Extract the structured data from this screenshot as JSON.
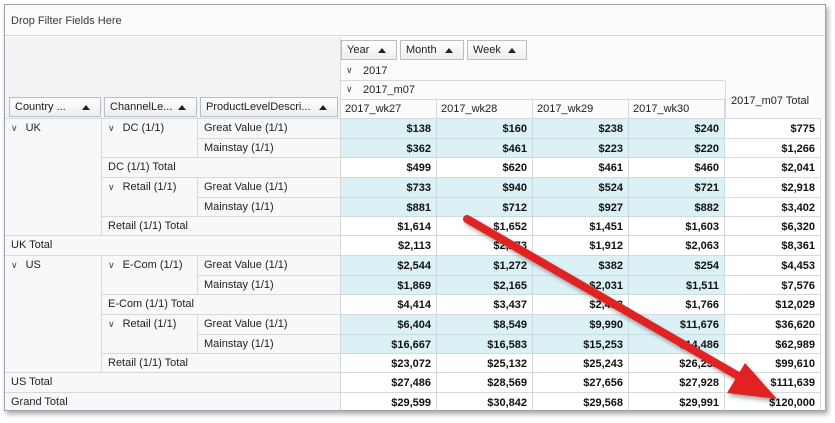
{
  "filter_area": {
    "label": "Drop Filter Fields Here"
  },
  "column_fields": [
    {
      "label": "Year"
    },
    {
      "label": "Month"
    },
    {
      "label": "Week"
    }
  ],
  "row_fields": [
    {
      "label": "Country ..."
    },
    {
      "label": "ChannelLe..."
    },
    {
      "label": "ProductLevelDescri..."
    }
  ],
  "column_headers": {
    "year": "2017",
    "month": "2017_m07",
    "weeks": [
      "2017_wk27",
      "2017_wk28",
      "2017_wk29",
      "2017_wk30"
    ],
    "month_total": "2017_m07 Total"
  },
  "rows": [
    {
      "country": "UK",
      "channel": "DC (1/1)",
      "product": "Great Value (1/1)",
      "values": [
        "$138",
        "$160",
        "$238",
        "$240",
        "$775"
      ]
    },
    {
      "product": "Mainstay (1/1)",
      "values": [
        "$362",
        "$461",
        "$223",
        "$220",
        "$1,266"
      ]
    },
    {
      "channel_total": "DC (1/1) Total",
      "values": [
        "$499",
        "$620",
        "$461",
        "$460",
        "$2,041"
      ]
    },
    {
      "channel": "Retail (1/1)",
      "product": "Great Value (1/1)",
      "values": [
        "$733",
        "$940",
        "$524",
        "$721",
        "$2,918"
      ]
    },
    {
      "product": "Mainstay (1/1)",
      "values": [
        "$881",
        "$712",
        "$927",
        "$882",
        "$3,402"
      ]
    },
    {
      "channel_total": "Retail (1/1) Total",
      "values": [
        "$1,614",
        "$1,652",
        "$1,451",
        "$1,603",
        "$6,320"
      ]
    },
    {
      "country_total": "UK Total",
      "values": [
        "$2,113",
        "$2,273",
        "$1,912",
        "$2,063",
        "$8,361"
      ]
    },
    {
      "country": "US",
      "channel": "E-Com (1/1)",
      "product": "Great Value (1/1)",
      "values": [
        "$2,544",
        "$1,272",
        "$382",
        "$254",
        "$4,453"
      ]
    },
    {
      "product": "Mainstay (1/1)",
      "values": [
        "$1,869",
        "$2,165",
        "$2,031",
        "$1,511",
        "$7,576"
      ]
    },
    {
      "channel_total": "E-Com (1/1) Total",
      "values": [
        "$4,414",
        "$3,437",
        "$2,413",
        "$1,766",
        "$12,029"
      ]
    },
    {
      "channel": "Retail (1/1)",
      "product": "Great Value (1/1)",
      "values": [
        "$6,404",
        "$8,549",
        "$9,990",
        "$11,676",
        "$36,620"
      ]
    },
    {
      "product": "Mainstay (1/1)",
      "values": [
        "$16,667",
        "$16,583",
        "$15,253",
        "$14,486",
        "$62,989"
      ]
    },
    {
      "channel_total": "Retail (1/1) Total",
      "values": [
        "$23,072",
        "$25,132",
        "$25,243",
        "$26,252",
        "$99,610"
      ]
    },
    {
      "country_total": "US Total",
      "values": [
        "$27,486",
        "$28,569",
        "$27,656",
        "$27,928",
        "$111,639"
      ]
    },
    {
      "grand_total": "Grand Total",
      "values": [
        "$29,599",
        "$30,842",
        "$29,568",
        "$29,991",
        "$120,000"
      ]
    }
  ],
  "annotation": {
    "type": "red-arrow",
    "color": "#e02020"
  },
  "colors": {
    "data_cell": "#dcf1f6",
    "total_cell": "#ffffff",
    "grid_line": "#d5d9de",
    "arrow": "#e02020"
  }
}
